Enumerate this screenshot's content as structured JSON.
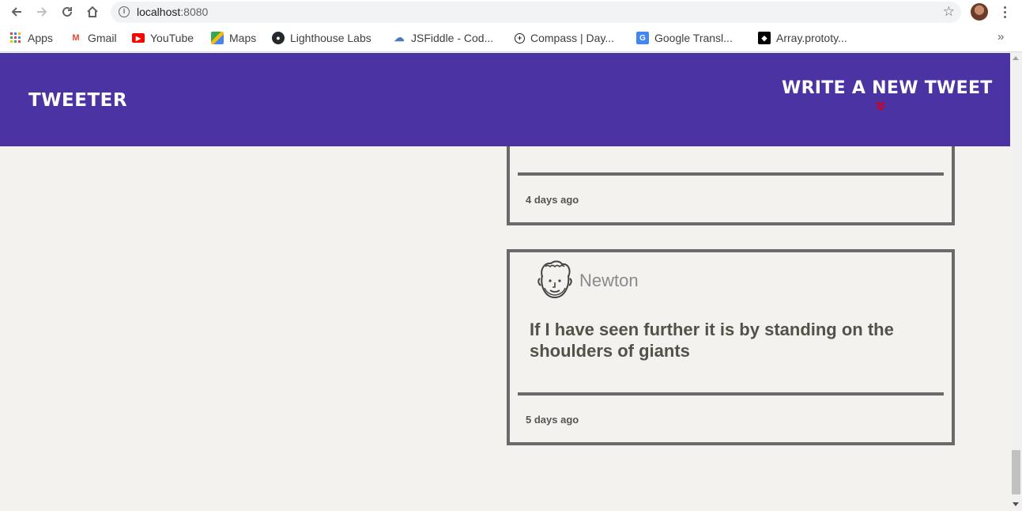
{
  "browser": {
    "url_host": "localhost",
    "url_port": ":8080",
    "bookmarks": [
      {
        "label": "Apps",
        "icon": "apps-grid-icon"
      },
      {
        "label": "Gmail",
        "icon": "gmail-icon"
      },
      {
        "label": "YouTube",
        "icon": "youtube-icon"
      },
      {
        "label": "Maps",
        "icon": "maps-icon"
      },
      {
        "label": "Lighthouse Labs",
        "icon": "github-icon"
      },
      {
        "label": "JSFiddle - Cod...",
        "icon": "jsfiddle-icon"
      },
      {
        "label": "Compass | Day...",
        "icon": "compass-icon"
      },
      {
        "label": "Google Transl...",
        "icon": "google-translate-icon"
      },
      {
        "label": "Array.prototy...",
        "icon": "mdn-icon"
      }
    ],
    "more": "»"
  },
  "header": {
    "brand": "Tweeter",
    "write_new_tweet": "Write a new tweet",
    "chevron": "»"
  },
  "tweets": [
    {
      "time": "4 days ago"
    },
    {
      "name": "Newton",
      "content": "If I have seen further it is by standing on the shoulders of giants",
      "time": "5 days ago"
    }
  ],
  "colors": {
    "nav_background": "#4b33a3",
    "page_background": "#f4f2ee",
    "accent_red": "#d0021b",
    "border": "#6a6a6a"
  }
}
